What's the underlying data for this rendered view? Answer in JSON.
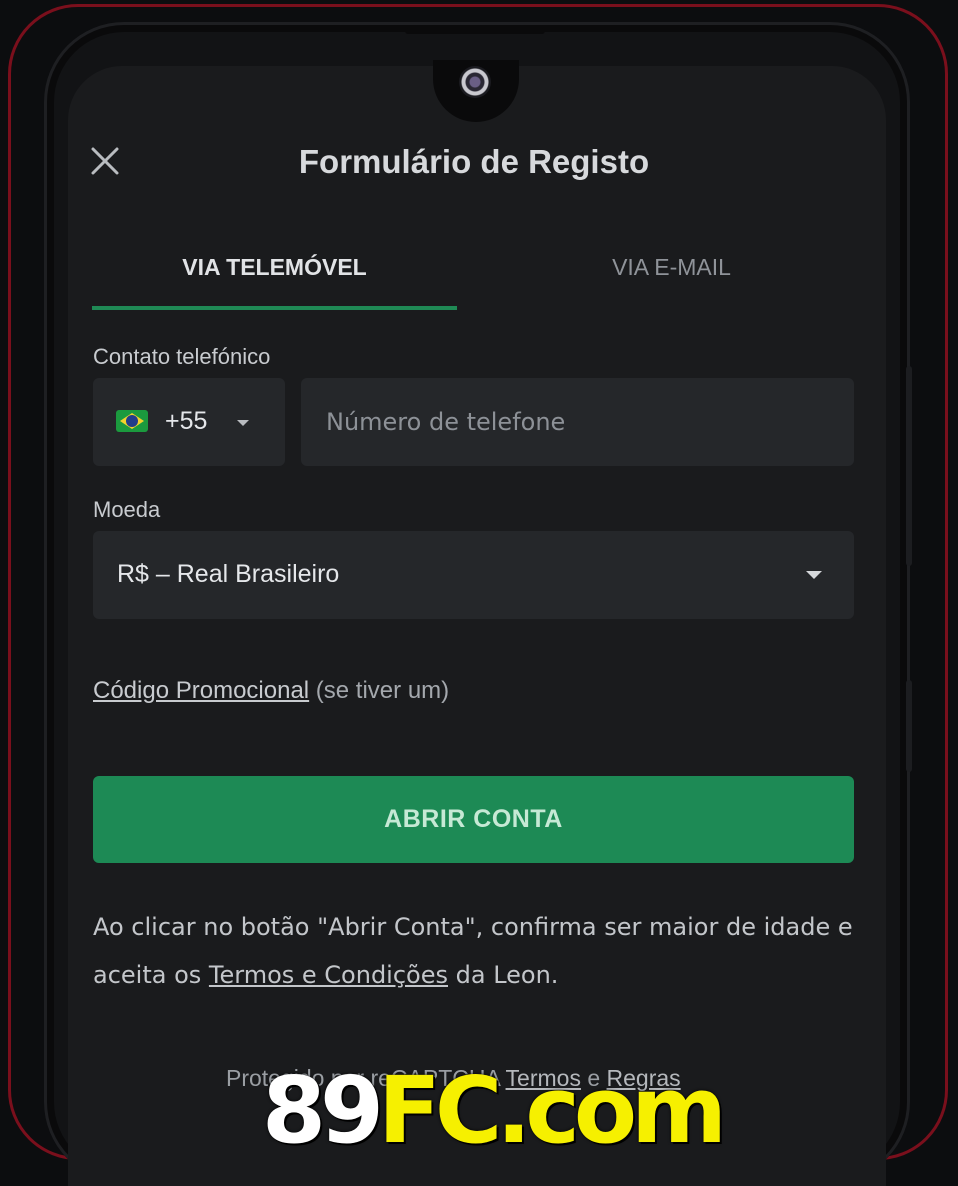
{
  "header": {
    "title": "Formulário de Registo"
  },
  "tabs": [
    {
      "label": "VIA TELEMÓVEL",
      "active": true
    },
    {
      "label": "VIA E-MAIL",
      "active": false
    }
  ],
  "form": {
    "phone_label": "Contato telefónico",
    "country_code": "+55",
    "phone_placeholder": "Número de telefone",
    "currency_label": "Moeda",
    "currency_value": "R$ – Real Brasileiro",
    "promo_link": "Código Promocional",
    "promo_hint": "(se tiver um)",
    "submit_label": "ABRIR CONTA"
  },
  "terms": {
    "prefix": "Ao clicar no botão \"Abrir Conta\", confirma ser maior de idade e aceita os ",
    "link": "Termos e Condições",
    "suffix": " da Leon."
  },
  "captcha": {
    "prefix": "Protegido por reCAPTCHA ",
    "terms_link": "Termos",
    "conj": " e ",
    "rules_link": "Regras"
  },
  "watermark": {
    "part1": "89",
    "part2": "FC.com"
  },
  "colors": {
    "accent": "#1d8a55",
    "background": "#1a1b1d",
    "field": "#25272a",
    "frame": "#7a0f1c"
  },
  "icons": {
    "close": "close-icon",
    "flag": "brazil-flag-icon",
    "dropdown": "chevron-down-icon"
  }
}
